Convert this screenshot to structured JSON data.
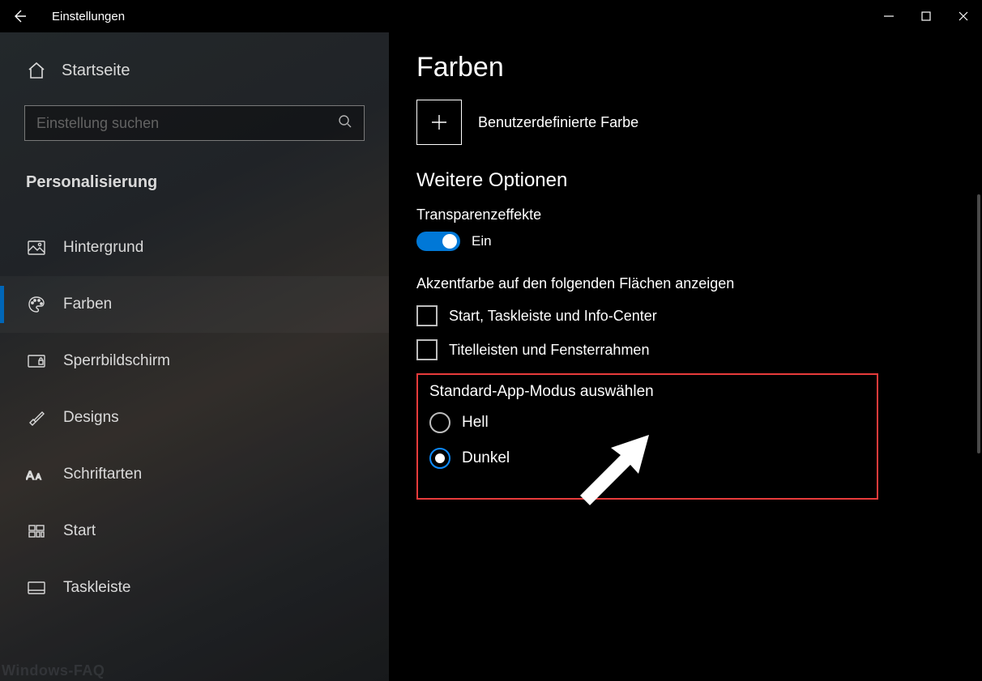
{
  "titlebar": {
    "title": "Einstellungen"
  },
  "sidebar": {
    "home": "Startseite",
    "search_placeholder": "Einstellung suchen",
    "section": "Personalisierung",
    "items": [
      {
        "label": "Hintergrund"
      },
      {
        "label": "Farben"
      },
      {
        "label": "Sperrbildschirm"
      },
      {
        "label": "Designs"
      },
      {
        "label": "Schriftarten"
      },
      {
        "label": "Start"
      },
      {
        "label": "Taskleiste"
      }
    ]
  },
  "content": {
    "title": "Farben",
    "custom_color_label": "Benutzerdefinierte Farbe",
    "more_options_heading": "Weitere Optionen",
    "transparency_label": "Transparenzeffekte",
    "transparency_state": "Ein",
    "accent_surfaces_heading": "Akzentfarbe auf den folgenden Flächen anzeigen",
    "checkboxes": [
      {
        "label": "Start, Taskleiste und Info-Center",
        "checked": false
      },
      {
        "label": "Titelleisten und Fensterrahmen",
        "checked": false
      }
    ],
    "app_mode_heading": "Standard-App-Modus auswählen",
    "app_mode_options": [
      {
        "label": "Hell",
        "selected": false
      },
      {
        "label": "Dunkel",
        "selected": true
      }
    ]
  },
  "colors": {
    "accent": "#0078d7",
    "highlight_border": "#e83b3b"
  },
  "watermark": "Windows-FAQ"
}
